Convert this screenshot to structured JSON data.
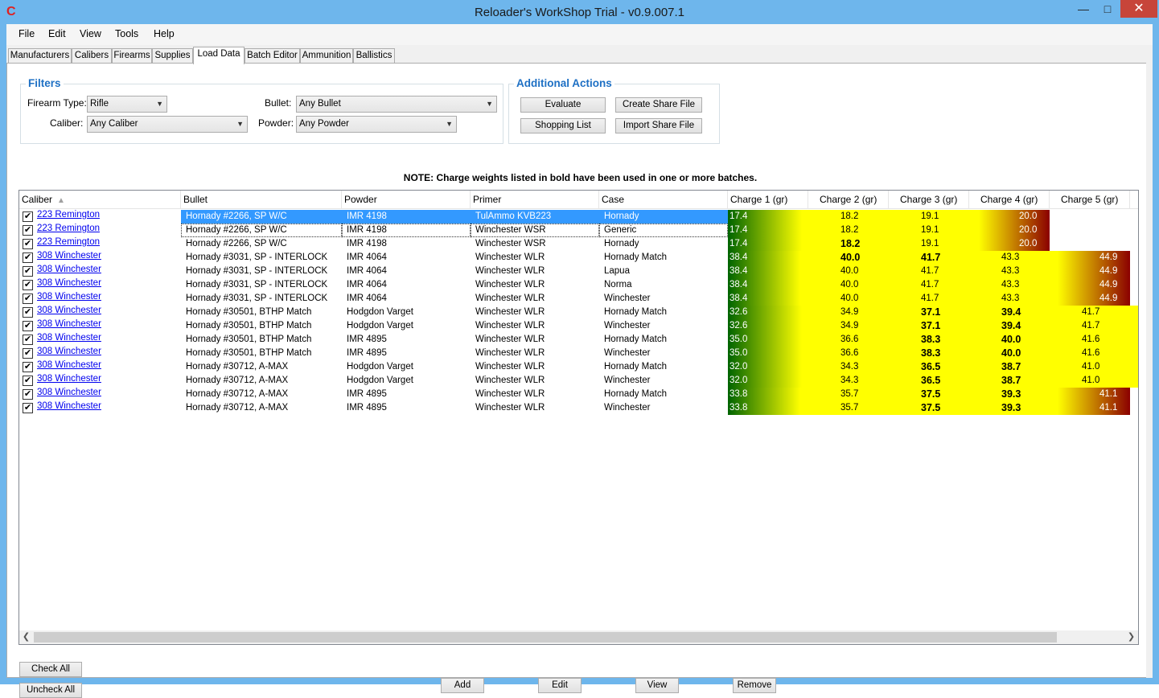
{
  "window": {
    "title": "Reloader's WorkShop Trial - v0.9.007.1"
  },
  "menu": [
    "File",
    "Edit",
    "View",
    "Tools",
    "Help"
  ],
  "tabs": [
    "Manufacturers",
    "Calibers",
    "Firearms",
    "Supplies",
    "Load Data",
    "Batch Editor",
    "Ammunition",
    "Ballistics"
  ],
  "active_tab": "Load Data",
  "filters": {
    "title": "Filters",
    "firearm_type_label": "Firearm Type:",
    "firearm_type_value": "Rifle",
    "caliber_label": "Caliber:",
    "caliber_value": "Any Caliber",
    "bullet_label": "Bullet:",
    "bullet_value": "Any Bullet",
    "powder_label": "Powder:",
    "powder_value": "Any Powder"
  },
  "actions": {
    "title": "Additional Actions",
    "evaluate": "Evaluate",
    "create_share": "Create Share File",
    "shopping_list": "Shopping List",
    "import_share": "Import Share File"
  },
  "note": "NOTE: Charge weights listed in bold have been used in one or more batches.",
  "columns": [
    "Caliber",
    "Bullet",
    "Powder",
    "Primer",
    "Case",
    "Charge 1 (gr)",
    "Charge 2 (gr)",
    "Charge 3 (gr)",
    "Charge 4 (gr)",
    "Charge 5 (gr)"
  ],
  "rows": [
    {
      "caliber": "223 Remington",
      "bullet": "Hornady #2266, SP W/C",
      "powder": "IMR 4198",
      "primer": "TulAmmo KVB223",
      "case": "Hornady",
      "charges": [
        "17.4",
        "18.2",
        "19.1",
        "20.0"
      ],
      "bold": []
    },
    {
      "caliber": "223 Remington",
      "bullet": "Hornady #2266, SP W/C",
      "powder": "IMR 4198",
      "primer": "Winchester WSR",
      "case": "Generic",
      "charges": [
        "17.4",
        "18.2",
        "19.1",
        "20.0"
      ],
      "bold": []
    },
    {
      "caliber": "223 Remington",
      "bullet": "Hornady #2266, SP W/C",
      "powder": "IMR 4198",
      "primer": "Winchester WSR",
      "case": "Hornady",
      "charges": [
        "17.4",
        "18.2",
        "19.1",
        "20.0"
      ],
      "bold": [
        1
      ]
    },
    {
      "caliber": "308 Winchester",
      "bullet": "Hornady #3031, SP - INTERLOCK",
      "powder": "IMR 4064",
      "primer": "Winchester WLR",
      "case": "Hornady Match",
      "charges": [
        "38.4",
        "40.0",
        "41.7",
        "43.3",
        "44.9"
      ],
      "bold": [
        1,
        2
      ]
    },
    {
      "caliber": "308 Winchester",
      "bullet": "Hornady #3031, SP - INTERLOCK",
      "powder": "IMR 4064",
      "primer": "Winchester WLR",
      "case": "Lapua",
      "charges": [
        "38.4",
        "40.0",
        "41.7",
        "43.3",
        "44.9"
      ],
      "bold": []
    },
    {
      "caliber": "308 Winchester",
      "bullet": "Hornady #3031, SP - INTERLOCK",
      "powder": "IMR 4064",
      "primer": "Winchester WLR",
      "case": "Norma",
      "charges": [
        "38.4",
        "40.0",
        "41.7",
        "43.3",
        "44.9"
      ],
      "bold": []
    },
    {
      "caliber": "308 Winchester",
      "bullet": "Hornady #3031, SP - INTERLOCK",
      "powder": "IMR 4064",
      "primer": "Winchester WLR",
      "case": "Winchester",
      "charges": [
        "38.4",
        "40.0",
        "41.7",
        "43.3",
        "44.9"
      ],
      "bold": []
    },
    {
      "caliber": "308 Winchester",
      "bullet": "Hornady #30501, BTHP Match",
      "powder": "Hodgdon Varget",
      "primer": "Winchester WLR",
      "case": "Hornady Match",
      "charges": [
        "32.6",
        "34.9",
        "37.1",
        "39.4",
        "41.7"
      ],
      "bold": [
        2,
        3
      ]
    },
    {
      "caliber": "308 Winchester",
      "bullet": "Hornady #30501, BTHP Match",
      "powder": "Hodgdon Varget",
      "primer": "Winchester WLR",
      "case": "Winchester",
      "charges": [
        "32.6",
        "34.9",
        "37.1",
        "39.4",
        "41.7"
      ],
      "bold": [
        2,
        3
      ]
    },
    {
      "caliber": "308 Winchester",
      "bullet": "Hornady #30501, BTHP Match",
      "powder": "IMR 4895",
      "primer": "Winchester WLR",
      "case": "Hornady Match",
      "charges": [
        "35.0",
        "36.6",
        "38.3",
        "40.0",
        "41.6"
      ],
      "bold": [
        2,
        3
      ]
    },
    {
      "caliber": "308 Winchester",
      "bullet": "Hornady #30501, BTHP Match",
      "powder": "IMR 4895",
      "primer": "Winchester WLR",
      "case": "Winchester",
      "charges": [
        "35.0",
        "36.6",
        "38.3",
        "40.0",
        "41.6"
      ],
      "bold": [
        2,
        3
      ]
    },
    {
      "caliber": "308 Winchester",
      "bullet": "Hornady #30712, A-MAX",
      "powder": "Hodgdon Varget",
      "primer": "Winchester WLR",
      "case": "Hornady Match",
      "charges": [
        "32.0",
        "34.3",
        "36.5",
        "38.7",
        "41.0"
      ],
      "bold": [
        2,
        3
      ]
    },
    {
      "caliber": "308 Winchester",
      "bullet": "Hornady #30712, A-MAX",
      "powder": "Hodgdon Varget",
      "primer": "Winchester WLR",
      "case": "Winchester",
      "charges": [
        "32.0",
        "34.3",
        "36.5",
        "38.7",
        "41.0"
      ],
      "bold": [
        2,
        3
      ]
    },
    {
      "caliber": "308 Winchester",
      "bullet": "Hornady #30712, A-MAX",
      "powder": "IMR 4895",
      "primer": "Winchester WLR",
      "case": "Hornady Match",
      "charges": [
        "33.8",
        "35.7",
        "37.5",
        "39.3",
        "41.1"
      ],
      "bold": [
        2,
        3
      ]
    },
    {
      "caliber": "308 Winchester",
      "bullet": "Hornady #30712, A-MAX",
      "powder": "IMR 4895",
      "primer": "Winchester WLR",
      "case": "Winchester",
      "charges": [
        "33.8",
        "35.7",
        "37.5",
        "39.3",
        "41.1"
      ],
      "bold": [
        2,
        3
      ]
    }
  ],
  "buttons": {
    "check_all": "Check All",
    "uncheck_all": "Uncheck All",
    "add": "Add",
    "edit": "Edit",
    "view": "View",
    "remove": "Remove"
  },
  "colors": {
    "min": "#006400",
    "mid": "#ffff00",
    "max": "#8b0000",
    "selection": "#3399ff",
    "group_title": "#1e70c4"
  }
}
